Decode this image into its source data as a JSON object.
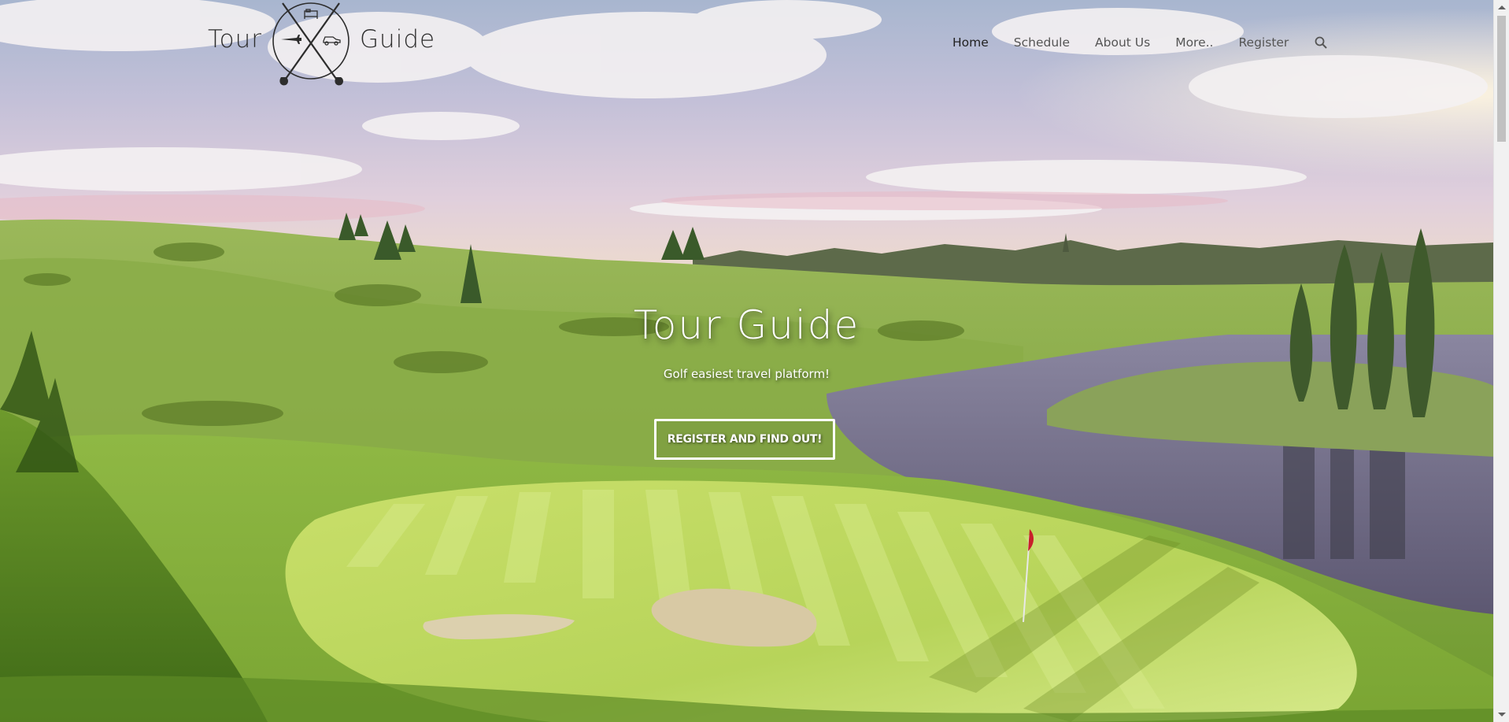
{
  "header": {
    "brand_left": "Tour",
    "brand_right": "Guide",
    "logo_icons": [
      "bed-icon",
      "airplane-icon",
      "car-icon",
      "golf-club-icon"
    ],
    "nav": [
      {
        "label": "Home",
        "active": true
      },
      {
        "label": "Schedule",
        "active": false
      },
      {
        "label": "About Us",
        "active": false
      },
      {
        "label": "More..",
        "active": false
      },
      {
        "label": "Register",
        "active": false
      }
    ],
    "search_icon": "search-icon"
  },
  "hero": {
    "title": "Tour Guide",
    "subtitle": "Golf easiest travel platform!",
    "cta_label": "REGISTER AND FIND OUT!",
    "background": "golf-course-landscape"
  },
  "colors": {
    "nav_text": "#555555",
    "nav_active": "#222222",
    "hero_text": "#ffffff",
    "grass": "#8fbf3a",
    "water": "#6b6680",
    "sky": "#c9c6dc"
  }
}
